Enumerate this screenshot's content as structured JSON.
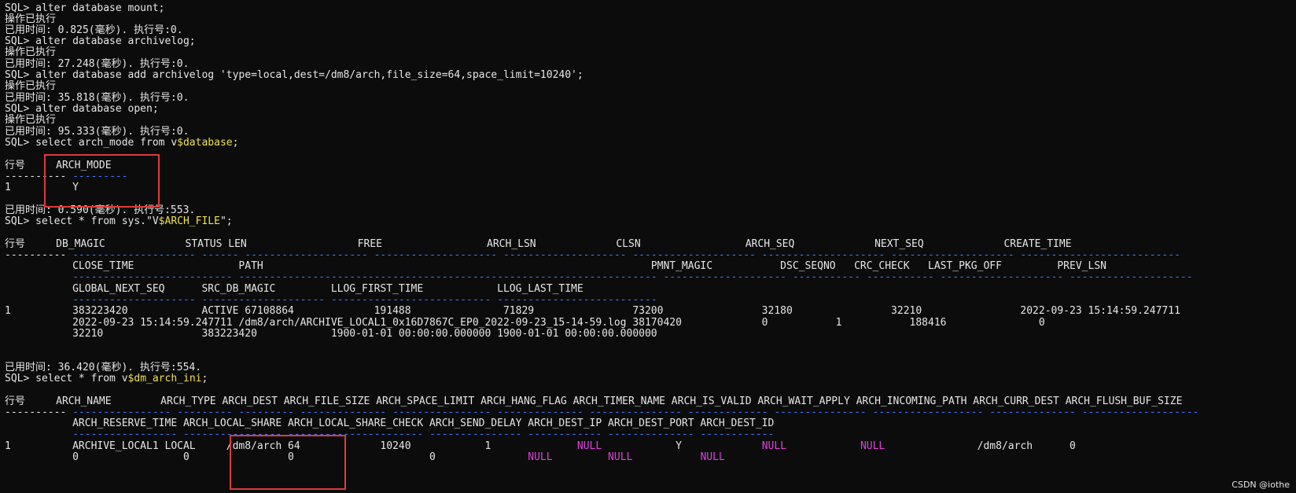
{
  "terminal": {
    "lines": {
      "l0": "SQL> alter database mount;",
      "l1": "操作已执行",
      "l2": "已用时间: 0.825(毫秒). 执行号:0.",
      "l3": "SQL> alter database archivelog;",
      "l4": "操作已执行",
      "l5": "已用时间: 27.248(毫秒). 执行号:0.",
      "l6": "SQL> alter database add archivelog 'type=local,dest=/dm8/arch,file_size=64,space_limit=10240';",
      "l7": "操作已执行",
      "l8": "已用时间: 35.818(毫秒). 执行号:0.",
      "l9": "SQL> alter database open;",
      "l10": "操作已执行",
      "l11": "已用时间: 95.333(毫秒). 执行号:0.",
      "l12_a": "SQL> select arch_mode from v",
      "l12_b": "$database",
      "l12_c": ";",
      "l14": "行号     ARCH_MODE",
      "l15_a": "---------- ",
      "l15_b": "---------",
      "l16": "1          Y",
      "l18": "已用时间: 0.590(毫秒). 执行号:553.",
      "l19_a": "SQL> select * from sys.\"V",
      "l19_b": "$ARCH_FILE",
      "l19_c": "\";",
      "l21": "行号     DB_MAGIC             STATUS LEN                  FREE                 ARCH_LSN             CLSN                 ARCH_SEQ             NEXT_SEQ             CREATE_TIME",
      "l22_a": "---------- ",
      "l22_b": "-------------------- ------ -------------------- -------------------- -------------------- -------------------- -------------------- -------------------- --------------------------",
      "l23": "           CLOSE_TIME                 PATH                                                               PMNT_MAGIC           DSC_SEQNO   CRC_CHECK   LAST_PKG_OFF         PREV_LSN",
      "l24": "           -------------------------- -------------------------------------------------------------------- -------------------- ----------- ----------- -------------------- --------------------",
      "l25": "           GLOBAL_NEXT_SEQ      SRC_DB_MAGIC         LLOG_FIRST_TIME            LLOG_LAST_TIME",
      "l26": "           -------------------- -------------------- -------------------------- --------------------------",
      "l27": "1          383223420            ACTIVE 67108864             191488               71829                73200                32180                32210                2022-09-23 15:14:59.247711",
      "l28": "           2022-09-23 15:14:59.247711 /dm8/arch/ARCHIVE_LOCAL1_0x16D7867C_EP0_2022-09-23_15-14-59.log 38170420             0           1           188416               0",
      "l29": "           32210                383223420            1900-01-01 00:00:00.000000 1900-01-01 00:00:00.000000",
      "l32": "已用时间: 36.420(毫秒). 执行号:554.",
      "l33_a": "SQL> select * from v",
      "l33_b": "$dm_arch_ini",
      "l33_c": ";",
      "l35": "行号     ARCH_NAME        ARCH_TYPE ARCH_DEST ARCH_FILE_SIZE ARCH_SPACE_LIMIT ARCH_HANG_FLAG ARCH_TIMER_NAME ARCH_IS_VALID ARCH_WAIT_APPLY ARCH_INCOMING_PATH ARCH_CURR_DEST ARCH_FLUSH_BUF_SIZE",
      "l36_a": "---------- ",
      "l36_b": "---------------- --------- --------- -------------- ---------------- -------------- --------------- ------------- --------------- ------------------ -------------- -------------------",
      "l37": "           ARCH_RESERVE_TIME ARCH_LOCAL_SHARE ARCH_LOCAL_SHARE_CHECK ARCH_SEND_DELAY ARCH_DEST_IP ARCH_DEST_PORT ARCH_DEST_ID",
      "l38": "           ----------------- ---------------- ---------------------- --------------- ------------ -------------- ------------",
      "l39_a": "1          ARCHIVE_LOCAL1 LOCAL     /dm8/arch 64             10240            1              ",
      "l39_null1": "NULL",
      "l39_b": "            Y             ",
      "l39_null2": "NULL",
      "l39_c": "            ",
      "l39_null3": "NULL",
      "l39_d": "               /dm8/arch      0",
      "l40_a": "           0                 0                0                      0               ",
      "l40_null1": "NULL",
      "l40_b": "         ",
      "l40_null2": "NULL",
      "l40_c": "           ",
      "l40_null3": "NULL"
    }
  },
  "watermark": "CSDN @iothe",
  "colors": {
    "background": "#0c0c0c",
    "text": "#e6e6e6",
    "separator": "#3b78ff",
    "identifier": "#f0e04a",
    "null_value": "#e040e0",
    "highlight_box": "#e03a3a"
  }
}
